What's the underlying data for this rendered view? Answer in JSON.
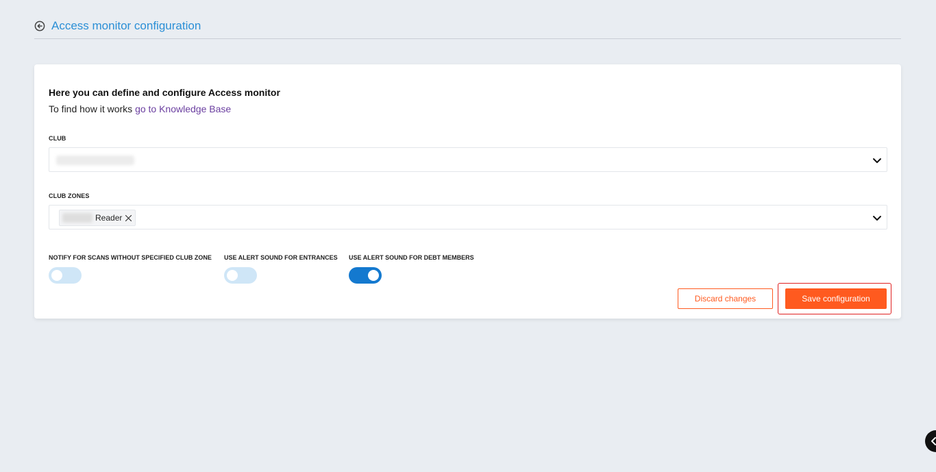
{
  "header": {
    "title": "Access monitor configuration",
    "back_icon": "back-arrow-circle-icon"
  },
  "intro": {
    "heading": "Here you can define and configure Access monitor",
    "prefix": "To find how it works ",
    "link_text": "go to Knowledge Base"
  },
  "club": {
    "label": "CLUB",
    "value_redacted": true
  },
  "club_zones": {
    "label": "CLUB ZONES",
    "chips": [
      {
        "label": "Reader"
      }
    ]
  },
  "toggles": [
    {
      "label": "NOTIFY FOR SCANS WITHOUT SPECIFIED CLUB ZONE",
      "on": false
    },
    {
      "label": "USE ALERT SOUND FOR ENTRANCES",
      "on": false
    },
    {
      "label": "USE ALERT SOUND FOR DEBT MEMBERS",
      "on": true
    }
  ],
  "actions": {
    "discard_label": "Discard changes",
    "save_label": "Save configuration"
  },
  "colors": {
    "accent": "#2b8fd6",
    "primary_button": "#ff5a1f",
    "toggle_on": "#1479cf",
    "toggle_off": "#cfe6f7",
    "highlight": "#e02020"
  }
}
